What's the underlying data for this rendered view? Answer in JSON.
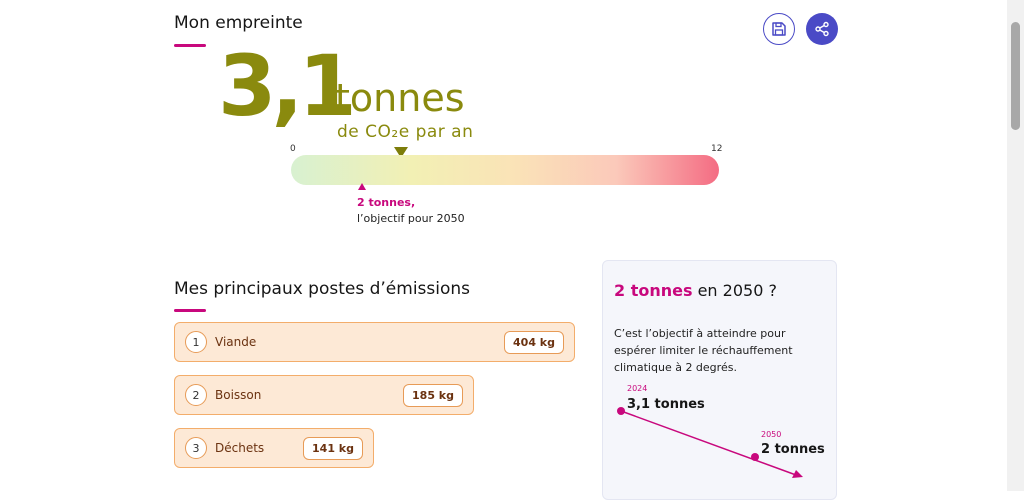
{
  "header": {
    "title": "Mon empreinte"
  },
  "actions": {
    "save_icon": "save-icon",
    "share_icon": "share-icon",
    "color": "#4a4ac6"
  },
  "footprint": {
    "value": "3,1",
    "unit": "tonnes",
    "subunit": "de CO₂e par an",
    "scale_min": "0",
    "scale_max": "12",
    "current_fraction": 0.258,
    "goal_fraction": 0.167,
    "goal_strong": "2 tonnes,",
    "goal_text": "l’objectif pour 2050",
    "accent": "#8a8a0e"
  },
  "emissions": {
    "title": "Mes principaux postes d’émissions",
    "items": [
      {
        "rank": "1",
        "label": "Viande",
        "value": "404 kg"
      },
      {
        "rank": "2",
        "label": "Boisson",
        "value": "185 kg"
      },
      {
        "rank": "3",
        "label": "Déchets",
        "value": "141 kg"
      }
    ]
  },
  "goal_card": {
    "title_highlight": "2 tonnes",
    "title_rest": " en 2050 ?",
    "text": "C’est l’objectif à atteindre pour espérer limiter le réchauffement climatique à 2 degrés.",
    "start_year": "2024",
    "start_value": "3,1 tonnes",
    "end_year": "2050",
    "end_value": "2 tonnes",
    "accent": "#c8087d"
  }
}
